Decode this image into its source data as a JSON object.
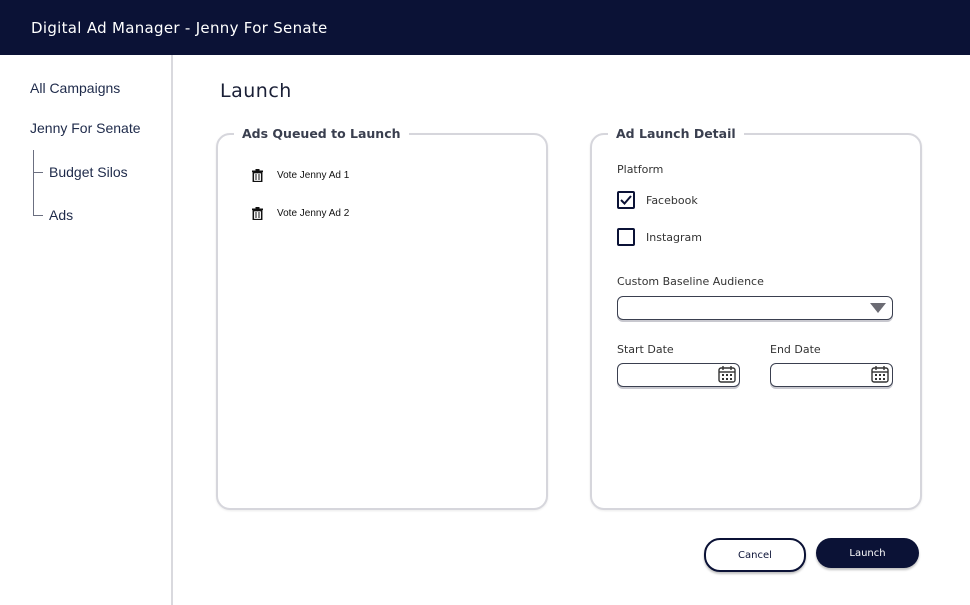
{
  "app": {
    "title": "Digital Ad Manager - Jenny For Senate"
  },
  "sidebar": {
    "items": [
      {
        "label": "All Campaigns"
      },
      {
        "label": "Jenny For Senate"
      },
      {
        "label": "Budget Silos"
      },
      {
        "label": "Ads"
      }
    ]
  },
  "page": {
    "title": "Launch"
  },
  "queue": {
    "legend": "Ads Queued to Launch",
    "items": [
      {
        "label": "Vote Jenny Ad 1",
        "icon": "trash-icon"
      },
      {
        "label": "Vote Jenny Ad 2",
        "icon": "trash-icon"
      }
    ]
  },
  "detail": {
    "legend": "Ad Launch Detail",
    "platform_label": "Platform",
    "platforms": [
      {
        "label": "Facebook",
        "checked": true
      },
      {
        "label": "Instagram",
        "checked": false
      }
    ],
    "audience_label": "Custom Baseline Audience",
    "audience_value": "",
    "start_label": "Start Date",
    "start_value": "",
    "end_label": "End Date",
    "end_value": ""
  },
  "actions": {
    "cancel_label": "Cancel",
    "launch_label": "Launch"
  },
  "colors": {
    "navy": "#0b1236",
    "border": "#d6d6dc"
  }
}
